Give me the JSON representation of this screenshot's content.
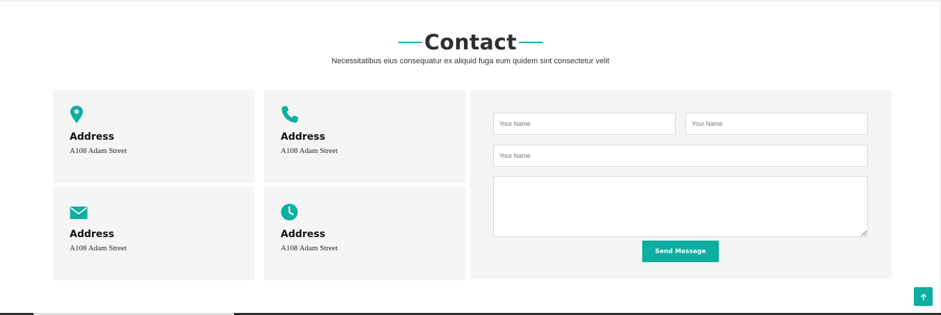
{
  "section": {
    "title": "Contact",
    "subtitle": "Necessitatibus eius consequatur ex aliquid fuga eum quidem sint consectetur velit"
  },
  "cards": [
    {
      "icon": "map-pin-icon",
      "label": "Address",
      "value": "A108 Adam Street"
    },
    {
      "icon": "phone-icon",
      "label": "Address",
      "value": "A108 Adam Street"
    },
    {
      "icon": "envelope-icon",
      "label": "Address",
      "value": "A108 Adam Street"
    },
    {
      "icon": "clock-icon",
      "label": "Address",
      "value": "A108 Adam Street"
    }
  ],
  "form": {
    "name_placeholder": "Your Name",
    "email_placeholder": "Your Name",
    "subject_placeholder": "Your Name",
    "message_placeholder": "",
    "submit_label": "Send Message"
  },
  "back_to_top": {
    "icon": "arrow-up-icon"
  },
  "colors": {
    "accent": "#0eaea1",
    "card_bg": "#f5f5f5",
    "title": "#2e2e33"
  }
}
